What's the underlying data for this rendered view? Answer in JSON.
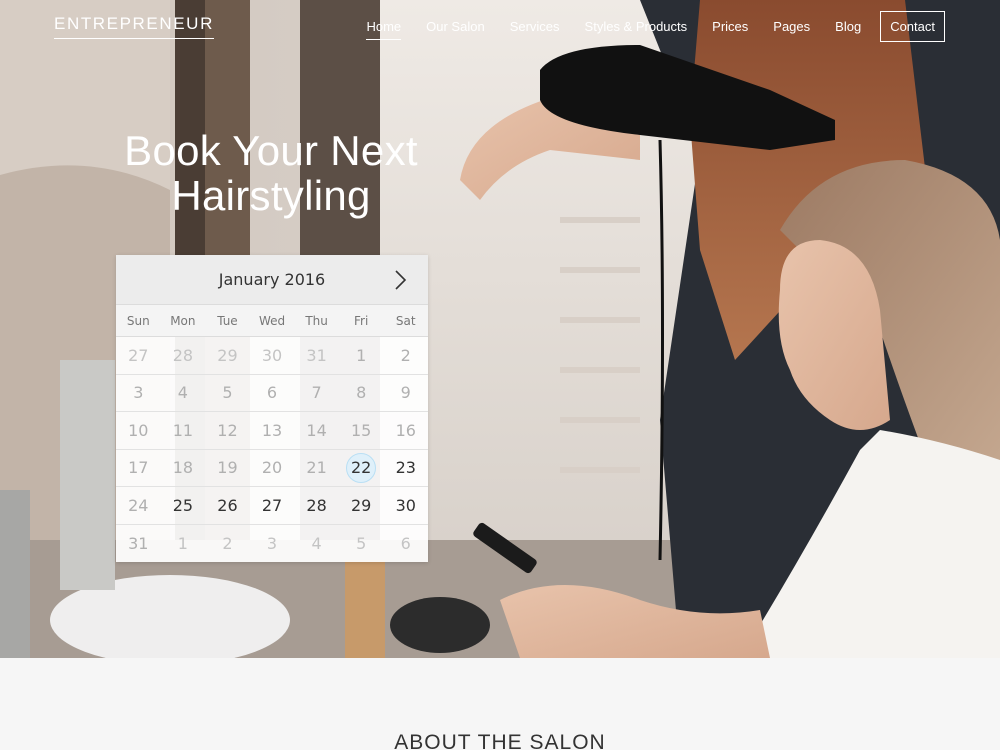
{
  "brand": {
    "logo": "ENTREPRENEUR"
  },
  "nav": {
    "items": [
      {
        "label": "Home"
      },
      {
        "label": "Our Salon"
      },
      {
        "label": "Services"
      },
      {
        "label": "Styles & Products"
      },
      {
        "label": "Prices"
      },
      {
        "label": "Pages"
      },
      {
        "label": "Blog"
      },
      {
        "label": "Contact"
      }
    ],
    "active": "Home"
  },
  "hero": {
    "headline_line1": "Book Your Next",
    "headline_line2": "Hairstyling"
  },
  "calendar": {
    "month_label": "January 2016",
    "next_icon": "chevron-right-icon",
    "weekdays": [
      "Sun",
      "Mon",
      "Tue",
      "Wed",
      "Thu",
      "Fri",
      "Sat"
    ],
    "weeks": [
      [
        "27",
        "28",
        "29",
        "30",
        "31",
        "1",
        "2"
      ],
      [
        "3",
        "4",
        "5",
        "6",
        "7",
        "8",
        "9"
      ],
      [
        "10",
        "11",
        "12",
        "13",
        "14",
        "15",
        "16"
      ],
      [
        "17",
        "18",
        "19",
        "20",
        "21",
        "22",
        "23"
      ],
      [
        "24",
        "25",
        "26",
        "27",
        "28",
        "29",
        "30"
      ],
      [
        "31",
        "1",
        "2",
        "3",
        "4",
        "5",
        "6"
      ]
    ],
    "today": "22",
    "today_highlight_color": "#dff0fa"
  },
  "about": {
    "title": "ABOUT THE SALON"
  },
  "colors": {
    "nav_text": "#ffffff",
    "calendar_header": "#ececec"
  }
}
